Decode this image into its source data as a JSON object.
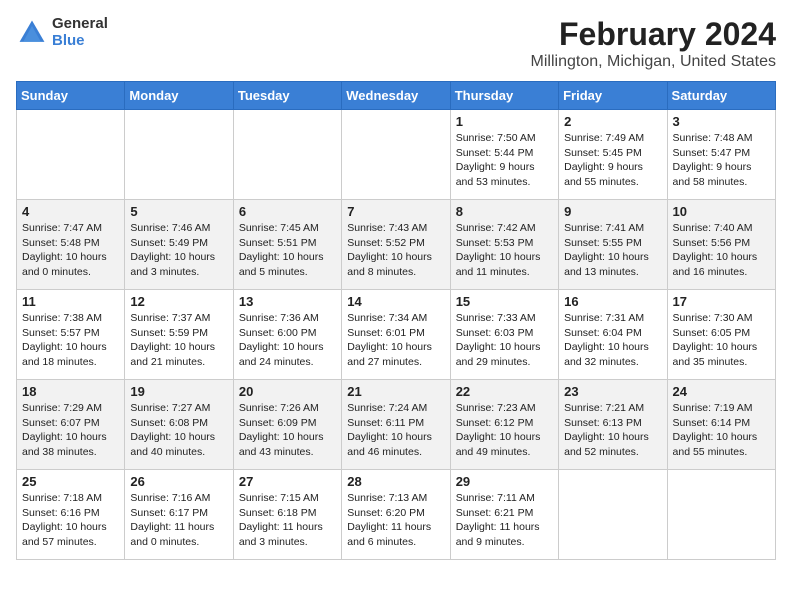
{
  "header": {
    "logo": {
      "general": "General",
      "blue": "Blue"
    },
    "title": "February 2024",
    "subtitle": "Millington, Michigan, United States"
  },
  "weekdays": [
    "Sunday",
    "Monday",
    "Tuesday",
    "Wednesday",
    "Thursday",
    "Friday",
    "Saturday"
  ],
  "weeks": [
    [
      {
        "day": "",
        "content": ""
      },
      {
        "day": "",
        "content": ""
      },
      {
        "day": "",
        "content": ""
      },
      {
        "day": "",
        "content": ""
      },
      {
        "day": "1",
        "content": "Sunrise: 7:50 AM\nSunset: 5:44 PM\nDaylight: 9 hours\nand 53 minutes."
      },
      {
        "day": "2",
        "content": "Sunrise: 7:49 AM\nSunset: 5:45 PM\nDaylight: 9 hours\nand 55 minutes."
      },
      {
        "day": "3",
        "content": "Sunrise: 7:48 AM\nSunset: 5:47 PM\nDaylight: 9 hours\nand 58 minutes."
      }
    ],
    [
      {
        "day": "4",
        "content": "Sunrise: 7:47 AM\nSunset: 5:48 PM\nDaylight: 10 hours\nand 0 minutes."
      },
      {
        "day": "5",
        "content": "Sunrise: 7:46 AM\nSunset: 5:49 PM\nDaylight: 10 hours\nand 3 minutes."
      },
      {
        "day": "6",
        "content": "Sunrise: 7:45 AM\nSunset: 5:51 PM\nDaylight: 10 hours\nand 5 minutes."
      },
      {
        "day": "7",
        "content": "Sunrise: 7:43 AM\nSunset: 5:52 PM\nDaylight: 10 hours\nand 8 minutes."
      },
      {
        "day": "8",
        "content": "Sunrise: 7:42 AM\nSunset: 5:53 PM\nDaylight: 10 hours\nand 11 minutes."
      },
      {
        "day": "9",
        "content": "Sunrise: 7:41 AM\nSunset: 5:55 PM\nDaylight: 10 hours\nand 13 minutes."
      },
      {
        "day": "10",
        "content": "Sunrise: 7:40 AM\nSunset: 5:56 PM\nDaylight: 10 hours\nand 16 minutes."
      }
    ],
    [
      {
        "day": "11",
        "content": "Sunrise: 7:38 AM\nSunset: 5:57 PM\nDaylight: 10 hours\nand 18 minutes."
      },
      {
        "day": "12",
        "content": "Sunrise: 7:37 AM\nSunset: 5:59 PM\nDaylight: 10 hours\nand 21 minutes."
      },
      {
        "day": "13",
        "content": "Sunrise: 7:36 AM\nSunset: 6:00 PM\nDaylight: 10 hours\nand 24 minutes."
      },
      {
        "day": "14",
        "content": "Sunrise: 7:34 AM\nSunset: 6:01 PM\nDaylight: 10 hours\nand 27 minutes."
      },
      {
        "day": "15",
        "content": "Sunrise: 7:33 AM\nSunset: 6:03 PM\nDaylight: 10 hours\nand 29 minutes."
      },
      {
        "day": "16",
        "content": "Sunrise: 7:31 AM\nSunset: 6:04 PM\nDaylight: 10 hours\nand 32 minutes."
      },
      {
        "day": "17",
        "content": "Sunrise: 7:30 AM\nSunset: 6:05 PM\nDaylight: 10 hours\nand 35 minutes."
      }
    ],
    [
      {
        "day": "18",
        "content": "Sunrise: 7:29 AM\nSunset: 6:07 PM\nDaylight: 10 hours\nand 38 minutes."
      },
      {
        "day": "19",
        "content": "Sunrise: 7:27 AM\nSunset: 6:08 PM\nDaylight: 10 hours\nand 40 minutes."
      },
      {
        "day": "20",
        "content": "Sunrise: 7:26 AM\nSunset: 6:09 PM\nDaylight: 10 hours\nand 43 minutes."
      },
      {
        "day": "21",
        "content": "Sunrise: 7:24 AM\nSunset: 6:11 PM\nDaylight: 10 hours\nand 46 minutes."
      },
      {
        "day": "22",
        "content": "Sunrise: 7:23 AM\nSunset: 6:12 PM\nDaylight: 10 hours\nand 49 minutes."
      },
      {
        "day": "23",
        "content": "Sunrise: 7:21 AM\nSunset: 6:13 PM\nDaylight: 10 hours\nand 52 minutes."
      },
      {
        "day": "24",
        "content": "Sunrise: 7:19 AM\nSunset: 6:14 PM\nDaylight: 10 hours\nand 55 minutes."
      }
    ],
    [
      {
        "day": "25",
        "content": "Sunrise: 7:18 AM\nSunset: 6:16 PM\nDaylight: 10 hours\nand 57 minutes."
      },
      {
        "day": "26",
        "content": "Sunrise: 7:16 AM\nSunset: 6:17 PM\nDaylight: 11 hours\nand 0 minutes."
      },
      {
        "day": "27",
        "content": "Sunrise: 7:15 AM\nSunset: 6:18 PM\nDaylight: 11 hours\nand 3 minutes."
      },
      {
        "day": "28",
        "content": "Sunrise: 7:13 AM\nSunset: 6:20 PM\nDaylight: 11 hours\nand 6 minutes."
      },
      {
        "day": "29",
        "content": "Sunrise: 7:11 AM\nSunset: 6:21 PM\nDaylight: 11 hours\nand 9 minutes."
      },
      {
        "day": "",
        "content": ""
      },
      {
        "day": "",
        "content": ""
      }
    ]
  ]
}
